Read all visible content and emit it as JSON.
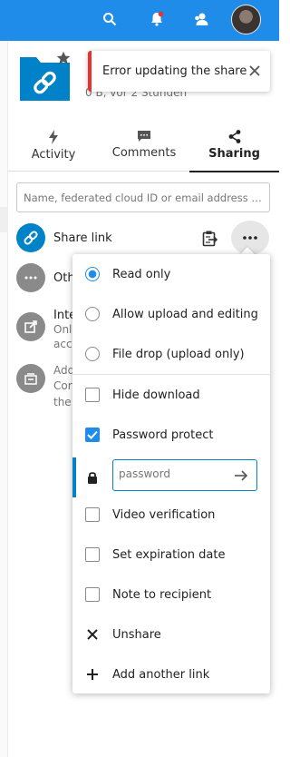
{
  "header": {
    "icons": [
      "search-icon",
      "notifications-icon",
      "contacts-icon"
    ],
    "notification_dot_color": "#e9322d",
    "accent": "#1f8cea"
  },
  "file": {
    "name": "",
    "info": "0 B, vor 2 Stunden"
  },
  "toast": {
    "message": "Error updating the share",
    "accent": "#e9322d"
  },
  "tabs": [
    {
      "label": "Activity",
      "icon": "flash-icon",
      "active": false
    },
    {
      "label": "Comments",
      "icon": "comment-icon",
      "active": false
    },
    {
      "label": "Sharing",
      "icon": "share-icon",
      "active": true
    }
  ],
  "sharing": {
    "search_placeholder": "Name, federated cloud ID or email address …",
    "share_link_label": "Share link",
    "others_label": "Oth",
    "internal": {
      "title": "Inte",
      "line1": "Onl",
      "line2": "acc"
    },
    "add": {
      "line1": "Add",
      "line2": "Cor",
      "line3": "the"
    }
  },
  "menu": {
    "read_only": "Read only",
    "allow_upload": "Allow upload and editing",
    "file_drop": "File drop (upload only)",
    "hide_download": "Hide download",
    "password_protect": "Password protect",
    "password_placeholder": "password",
    "video_verification": "Video verification",
    "set_expiration": "Set expiration date",
    "note": "Note to recipient",
    "unshare": "Unshare",
    "add_another": "Add another link",
    "selected_permission": "Read only",
    "password_checked": true
  }
}
